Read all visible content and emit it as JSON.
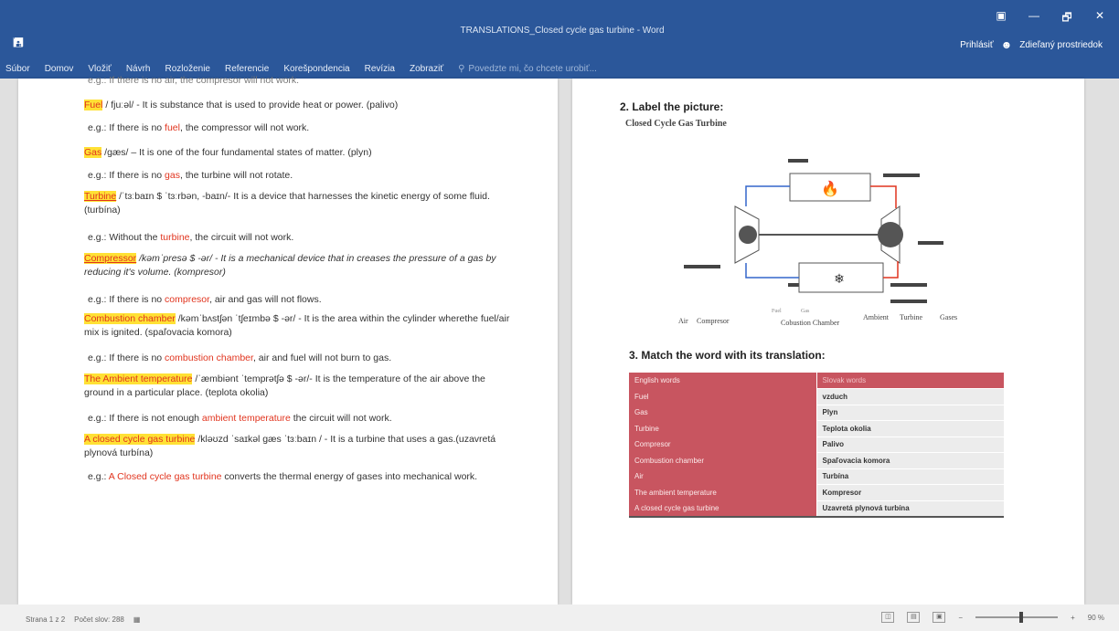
{
  "app": {
    "title": "TRANSLATIONS_Closed cycle gas turbine - Word",
    "save_icon": "save-icon",
    "window_controls": [
      "▣",
      "—",
      "🗗",
      "✕"
    ],
    "account": {
      "signin": "Prihlásiť",
      "share": "Zdieľaný prostriedok"
    }
  },
  "ribbon": {
    "tabs": [
      "Súbor",
      "Domov",
      "Vložiť",
      "Návrh",
      "Rozloženie",
      "Referencie",
      "Korešpondencia",
      "Revízia",
      "Zobraziť"
    ],
    "tell_me": "Povedzte mi, čo chcete urobiť..."
  },
  "left_page": {
    "top_line": "e.g.: If there is no air, the compresor will not work.",
    "entries": [
      {
        "term": "Fuel",
        "def": " / fjuːəl/ - It is substance that is used to provide heat or power. (palivo)"
      },
      {
        "ex_pre": "e.g.: If there is no ",
        "ex_term": "fuel",
        "ex_post": ", the compressor will not work."
      },
      {
        "term": "Gas",
        "def": " /gæs/ – It is one of the four fundamental states of matter. (plyn)"
      },
      {
        "ex_pre": "e.g.: If there is no ",
        "ex_term": "gas",
        "ex_post": ", the turbine will not rotate."
      },
      {
        "term": "Turbine",
        "def": " /ˈtɜːbaɪn $ ˈtɜːrbən, -baɪn/- It is a device that harnesses the kinetic energy of some fluid. (turbína)"
      },
      {
        "ex_pre": "e.g.: Without the ",
        "ex_term": "turbine",
        "ex_post": ", the circuit will not work."
      },
      {
        "term": "Compressor",
        "def": " /kəmˈpresə $ -ər/ - It is a mechanical device that in creases the pressure of a gas by reducing it's volume. (kompresor)"
      },
      {
        "ex_pre": "e.g.: If there is no ",
        "ex_term": "compresor",
        "ex_post": ", air and gas will not flows."
      },
      {
        "term": "Combustion chamber",
        "def": " /kəmˈbʌstʃən ˈtʃeɪmbə $ -ər/ - It is the area within the cylinder wherethe fuel/air mix is ignited. (spaľovacia komora)"
      },
      {
        "ex_pre": "e.g.: If there is no ",
        "ex_term": "combustion chamber",
        "ex_post": ", air and fuel will not burn to gas."
      },
      {
        "term": "The Ambient temperature",
        "def": " /ˈæmbiənt ˈtemprətʃə $ -ər/- It is the temperature of the air above the ground in a particular place. (teplota okolia)"
      },
      {
        "ex_pre": "e.g.: If there is not enough ",
        "ex_term": "ambient temperature",
        "ex_post": " the circuit will not work."
      },
      {
        "term": "A closed cycle gas turbine",
        "def": " /kləʊzd ˈsaɪkəl gæs ˈtɜːbaɪn / - It is a turbine that uses a gas.(uzavretá plynová turbína)"
      },
      {
        "ex_pre": "e.g.: ",
        "ex_term": "A Closed cycle gas turbine",
        "ex_post": " converts the thermal energy of gases into mechanical work."
      }
    ]
  },
  "right_page": {
    "label_heading": "2. Label the picture:",
    "diagram_title": "Closed Cycle Gas Turbine",
    "diagram_labels": {
      "air": "Air",
      "compressor": "Compresor",
      "fuel": "Fuel",
      "gas": "Gas",
      "combustion": "Cobustion Chamber",
      "ambient": "Ambient",
      "turbine": "Turbine",
      "gases": "Gases"
    },
    "match_heading": "3. Match the word with its translation:",
    "table": {
      "header": [
        "English words",
        "Slovak words"
      ],
      "rows": [
        [
          "Fuel",
          "vzduch"
        ],
        [
          "Gas",
          "Plyn"
        ],
        [
          "Turbine",
          "Teplota okolia"
        ],
        [
          "Compresor",
          "Palivo"
        ],
        [
          "Combustion chamber",
          "Spaľovacia komora"
        ],
        [
          "Air",
          "Turbína"
        ],
        [
          "The ambient temperature",
          "Kompresor"
        ],
        [
          "A closed cycle gas turbine",
          "Uzavretá plynová turbína"
        ]
      ]
    }
  },
  "status": {
    "page": "Strana 1 z 2",
    "words": "Počet slov: 288",
    "zoom": "90 %"
  }
}
